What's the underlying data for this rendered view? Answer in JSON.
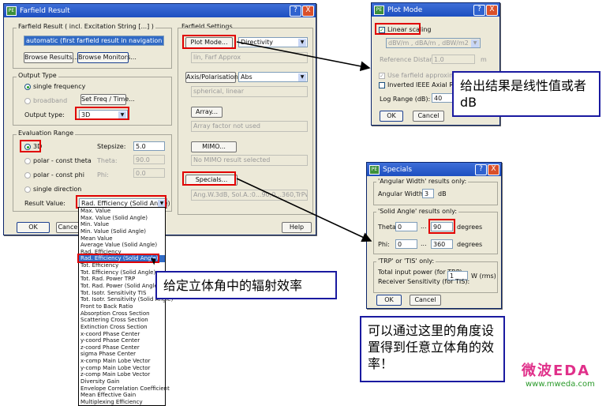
{
  "farfield": {
    "title": "Farfield Result",
    "close": "X",
    "help_btn": "?",
    "result_group": "Farfield Result ( incl. Excitation String [...] )",
    "result_value": "automatic (first farfield result in navigation tree)",
    "browse_results": "Browse Results...",
    "browse_monitors": "Browse Monitors...",
    "output_type_group": "Output Type",
    "single_frequency": "single frequency",
    "broadband": "broadband",
    "set_freq": "Set Freq / Time...",
    "output_type_label": "Output type:",
    "output_type_value": "3D",
    "eval_group": "Evaluation Range",
    "opt_3d": "3D",
    "stepsize_label": "Stepsize:",
    "stepsize_value": "5.0",
    "polar_theta": "polar - const theta",
    "theta_label": "Theta:",
    "theta_value": "90.0",
    "polar_phi": "polar - const phi",
    "phi_label": "Phi:",
    "phi_value": "0.0",
    "single_direction": "single direction",
    "result_value_label": "Result Value:",
    "result_value_selected": "Rad. Efficiency (Solid Angle)",
    "ok": "OK",
    "cancel": "Cancel",
    "help": "Help",
    "settings_group": "Farfield Settings",
    "plot_mode_btn": "Plot Mode...",
    "plot_mode_combo": "Directivity",
    "plot_mode_text": "lin, Farf Approx",
    "axis_btn": "Axis/Polarisation...",
    "axis_combo": "Abs",
    "axis_text": "spherical, linear",
    "array_btn": "Array...",
    "array_text": "Array factor not used",
    "mimo_btn": "MIMO...",
    "mimo_text": "No MIMO result selected",
    "specials_btn": "Specials...",
    "specials_text": "Ang.W.3dB, Sol.A.:0...90,0...360,TrPwms"
  },
  "result_options": [
    "Max. Value",
    "Max. Value (Solid Angle)",
    "Min. Value",
    "Min. Value (Solid Angle)",
    "Mean Value",
    "Average Value (Solid Angle)",
    "Rad. Efficiency",
    "Rad. Efficiency (Solid Angle)",
    "Tot. Efficiency",
    "Tot. Efficiency (Solid Angle)",
    "Tot. Rad. Power TRP",
    "Tot. Rad. Power (Solid Angle)",
    "Tot. Isotr. Sensitivity TIS",
    "Tot. Isotr. Sensitivity (Solid Angle)",
    "Front to Back Ratio",
    "Absorption Cross Section",
    "Scattering Cross Section",
    "Extinction Cross Section",
    "x-coord Phase Center",
    "y-coord Phase Center",
    "z-coord Phase Center",
    "sigma Phase Center",
    "x-comp Main Lobe Vector",
    "y-comp Main Lobe Vector",
    "z-comp Main Lobe Vector",
    "Diversity Gain",
    "Envelope Correlation Coefficient",
    "Mean Effective Gain",
    "Multiplexing Efficiency"
  ],
  "plot_mode": {
    "title": "Plot Mode",
    "close": "X",
    "help_btn": "?",
    "linear_scaling": "Linear scaling",
    "unit_combo": "dBV/m , dBA/m , dBW/m2",
    "ref_distance_label": "Reference Distance:",
    "ref_distance_value": "1.0",
    "ref_unit": "m",
    "use_farfield": "Use farfield approximation",
    "inverted_ieee": "Inverted IEEE Axial Ratio",
    "log_range_label": "Log Range (dB):",
    "log_range_value": "40",
    "ok": "OK",
    "cancel": "Cancel"
  },
  "specials": {
    "title": "Specials",
    "close": "X",
    "help_btn": "?",
    "angular_group": "'Angular Width' results only:",
    "angular_width_label": "Angular Width at",
    "angular_width_value": "3",
    "angular_width_unit": "dB",
    "solid_group": "'Solid Angle' results only:",
    "theta_label": "Theta:",
    "theta_from": "0",
    "theta_to": "90",
    "phi_label": "Phi:",
    "phi_from": "0",
    "phi_to": "360",
    "range_sep": "...",
    "degrees": "degrees",
    "trp_group": "'TRP' or 'TIS' only:",
    "total_power_label": "Total input power (for TRP):",
    "total_power_value": "1",
    "total_power_unit": "W (rms)",
    "receiver_label": "Receiver Sensitivity (for TIS):",
    "ok": "OK",
    "cancel": "Cancel"
  },
  "callouts": {
    "linear": "给出结果是线性值或者dB",
    "efficiency": "给定立体角中的辐射效率",
    "angle": "可以通过这里的角度设置得到任意立体角的效率！"
  },
  "watermark": {
    "brand": "微波EDA",
    "url": "www.mweda.com"
  },
  "colors": {
    "highlight_red": "#e00000",
    "callout_border": "#1a1aa0",
    "title_blue": "#1d4fc0",
    "watermark_green": "#2a9a2a",
    "watermark_pink": "#e0308a"
  }
}
